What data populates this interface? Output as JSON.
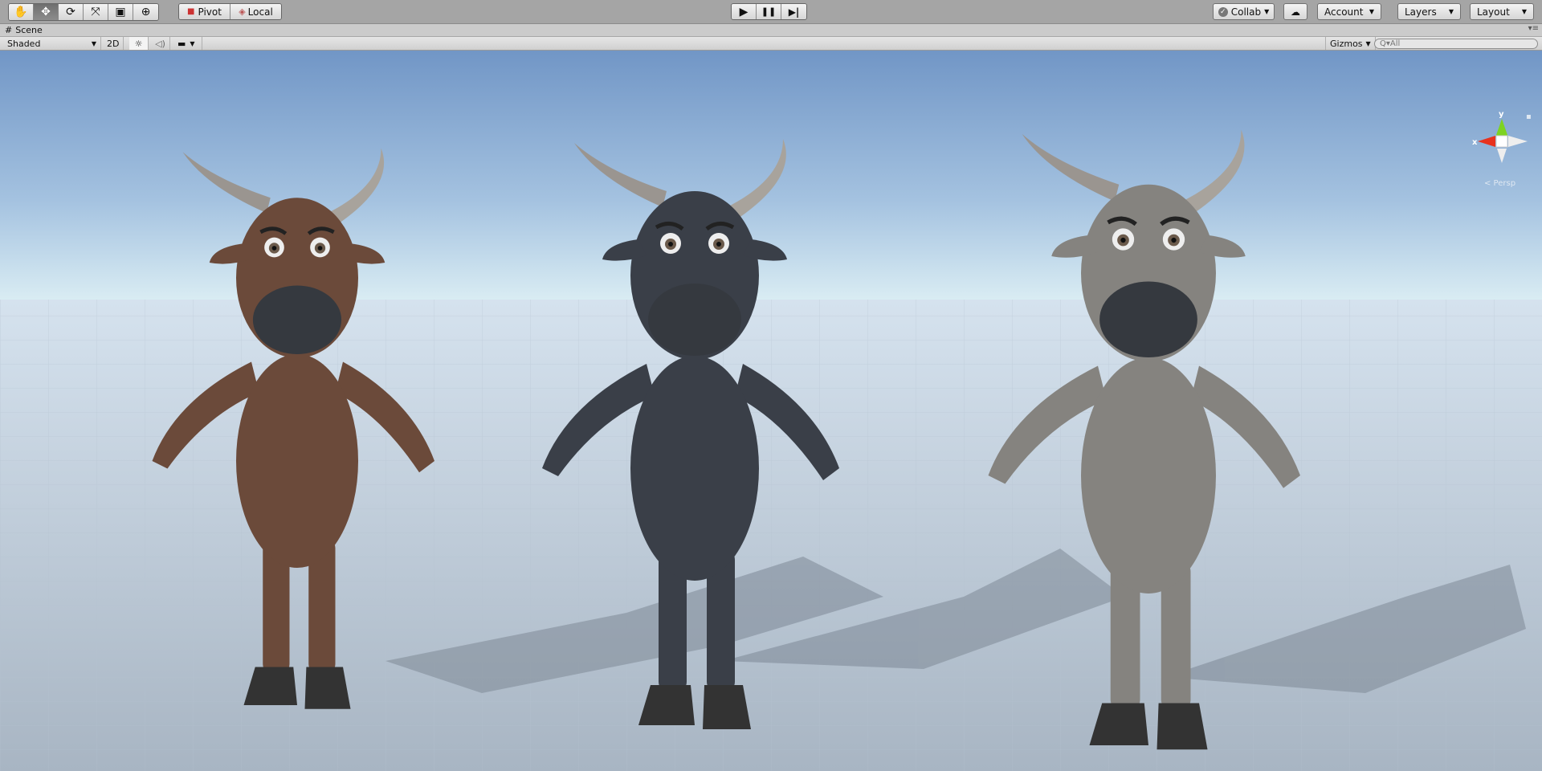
{
  "toolbar": {
    "tools": [
      {
        "name": "hand-tool",
        "icon": "✋"
      },
      {
        "name": "move-tool",
        "icon": "✥"
      },
      {
        "name": "rotate-tool",
        "icon": "⟳"
      },
      {
        "name": "scale-tool",
        "icon": "⤧"
      },
      {
        "name": "rect-tool",
        "icon": "▣"
      },
      {
        "name": "transform-tool",
        "icon": "⊕"
      }
    ],
    "pivot": "Pivot",
    "local": "Local",
    "play": "▶",
    "pause": "❚❚",
    "step": "▶|",
    "collab": "Collab",
    "account": "Account",
    "layers": "Layers",
    "layout": "Layout"
  },
  "scene_tab": {
    "icon": "#",
    "label": "Scene"
  },
  "scene_toolbar": {
    "draw_mode": "Shaded",
    "mode_2d": "2D",
    "gizmos": "Gizmos",
    "search_placeholder": "All"
  },
  "gizmo": {
    "y_label": "y",
    "x_label": "x",
    "projection": "< Persp",
    "colors": {
      "x": "#e8321e",
      "y": "#7ed321"
    }
  },
  "bulls": [
    {
      "color": "#6b4a3a"
    },
    {
      "color": "#3a3f48"
    },
    {
      "color": "#85837f"
    }
  ]
}
